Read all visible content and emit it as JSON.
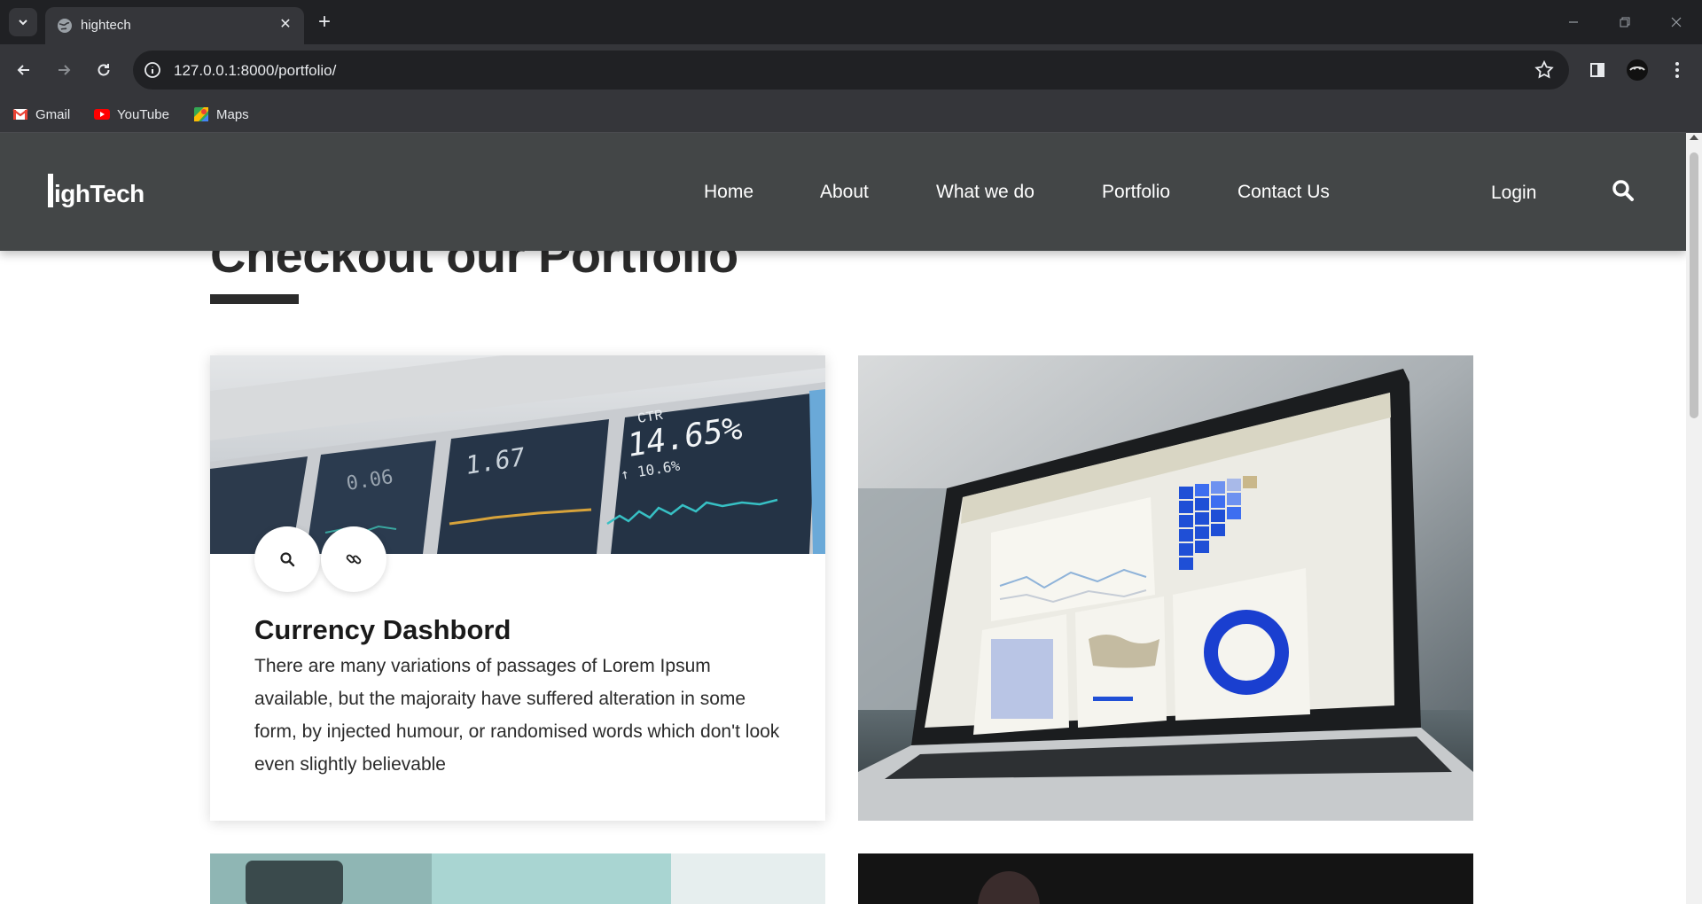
{
  "browser": {
    "tab_title": "hightech",
    "url": "127.0.0.1:8000/portfolio/",
    "bookmarks": [
      {
        "label": "Gmail",
        "icon": "gmail-icon"
      },
      {
        "label": "YouTube",
        "icon": "youtube-icon"
      },
      {
        "label": "Maps",
        "icon": "maps-icon"
      }
    ]
  },
  "site": {
    "logo": "ighTech",
    "logo_full": "HighTech",
    "nav": [
      "Home",
      "About",
      "What we do",
      "Portfolio",
      "Contact Us"
    ],
    "login": "Login"
  },
  "page": {
    "heading": "Checkout our Portfolio",
    "card": {
      "title": "Currency Dashbord",
      "text": "There are many variations of passages of Lorem Ipsum available, but the majoraity have suffered alteration in some form, by injected humour, or randomised words which don't look even slightly believable",
      "image_text": {
        "ctr_label": "CTR",
        "ctr_value": "14.65%",
        "ctr_delta": "↑ 10.6%",
        "val2": "1.67",
        "val1": "0.06"
      }
    }
  },
  "colors": {
    "header_bg": "#434647",
    "heading": "#2b2b2b"
  }
}
